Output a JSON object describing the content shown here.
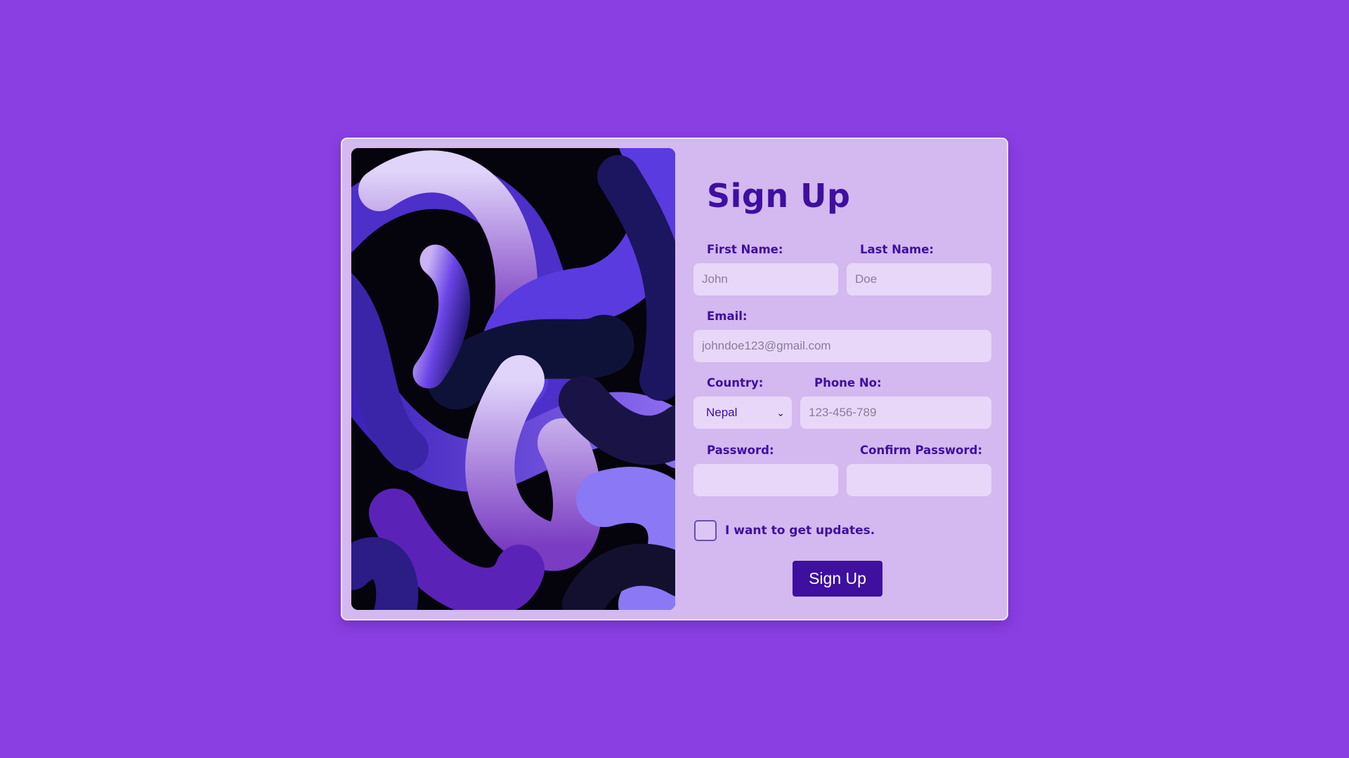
{
  "form": {
    "title": "Sign Up",
    "first_name": {
      "label": "First Name:",
      "placeholder": "John"
    },
    "last_name": {
      "label": "Last Name:",
      "placeholder": "Doe"
    },
    "email": {
      "label": "Email:",
      "placeholder": "johndoe123@gmail.com"
    },
    "country": {
      "label": "Country:",
      "selected": "Nepal"
    },
    "phone": {
      "label": "Phone No:",
      "placeholder": "123-456-789"
    },
    "password": {
      "label": "Password:",
      "placeholder": ""
    },
    "confirm_password": {
      "label": "Confirm Password:",
      "placeholder": ""
    },
    "updates_checkbox": {
      "label": "I want to get updates.",
      "checked": false
    },
    "submit_label": "Sign Up"
  },
  "colors": {
    "page_background": "#8a3fe3",
    "card_background": "#d4b8f0",
    "input_background": "#e8d7f9",
    "accent": "#3f0fa0"
  },
  "icons": {
    "select_arrow": "chevron-down-icon"
  }
}
